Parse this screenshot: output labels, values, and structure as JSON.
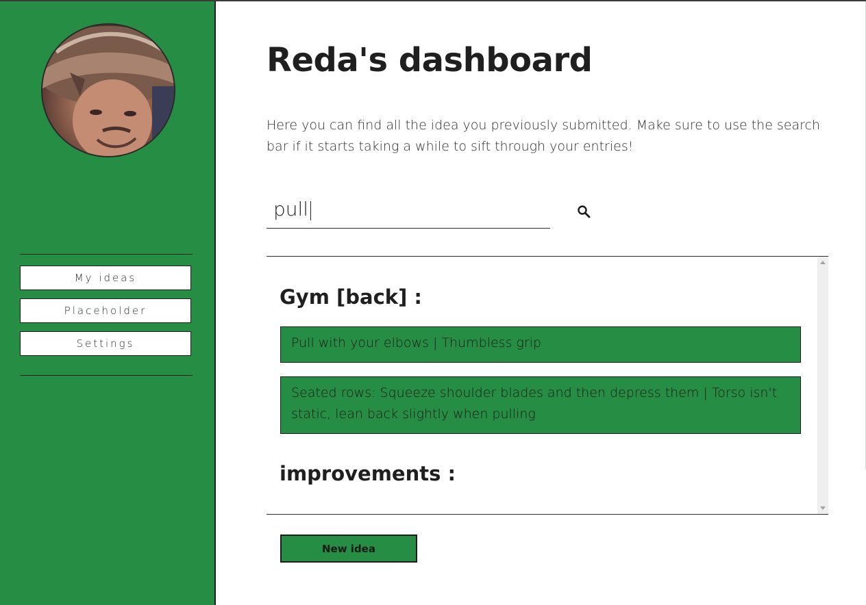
{
  "colors": {
    "accent": "#258e44",
    "border": "#1c1c1c",
    "background": "#ffffff",
    "text": "#1f1f1f"
  },
  "sidebar": {
    "avatar_icon": "user-avatar-photo",
    "items": [
      {
        "label": "My ideas"
      },
      {
        "label": "Placeholder"
      },
      {
        "label": "Settings"
      }
    ]
  },
  "main": {
    "title": "Reda's dashboard",
    "intro": "Here you can find all the idea you previously submitted. Make sure to use the search bar if it starts taking a while to sift through your entries!",
    "search": {
      "value": "pull",
      "icon": "search-icon"
    },
    "categories": [
      {
        "title": "Gym [back] :",
        "ideas": [
          "Pull with your elbows | Thumbless grip",
          "Seated rows: Squeeze shoulder blades and then depress them | Torso isn't static, lean back slightly when pulling"
        ]
      },
      {
        "title": "improvements :",
        "ideas": []
      }
    ],
    "new_idea_label": "New idea"
  }
}
